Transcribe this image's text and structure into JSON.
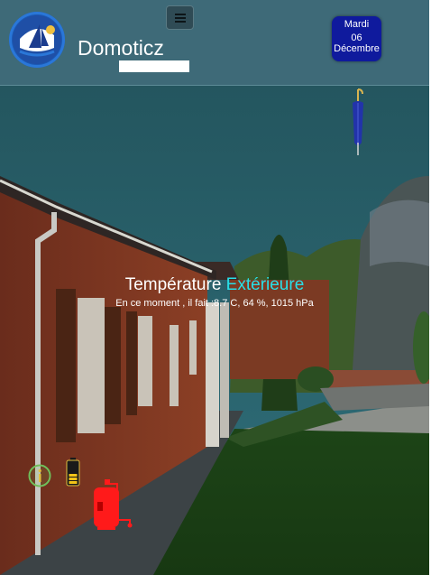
{
  "header": {
    "app_title": "Domoticz",
    "menu_icon": "hamburger-menu-icon",
    "logo_icon": "sailboat-logo-icon",
    "date": {
      "weekday": "Mardi",
      "day": "06",
      "month": "Décembre"
    }
  },
  "weather": {
    "icon": "umbrella-icon",
    "title_prefix": "Température",
    "title_accent": "Extérieure",
    "summary": "En ce moment , il fait :8.7 C, 64 %, 1015 hPa"
  },
  "status_icons": {
    "info": "info-circle-icon",
    "battery": "battery-icon",
    "boiler": "water-heater-icon"
  },
  "colors": {
    "header_bg": "#3e6a78",
    "date_box": "#0f1a9d",
    "accent": "#28dfe8",
    "boiler": "#ff1a1a",
    "battery": "#f2c418",
    "info": "#6fbf5a"
  }
}
